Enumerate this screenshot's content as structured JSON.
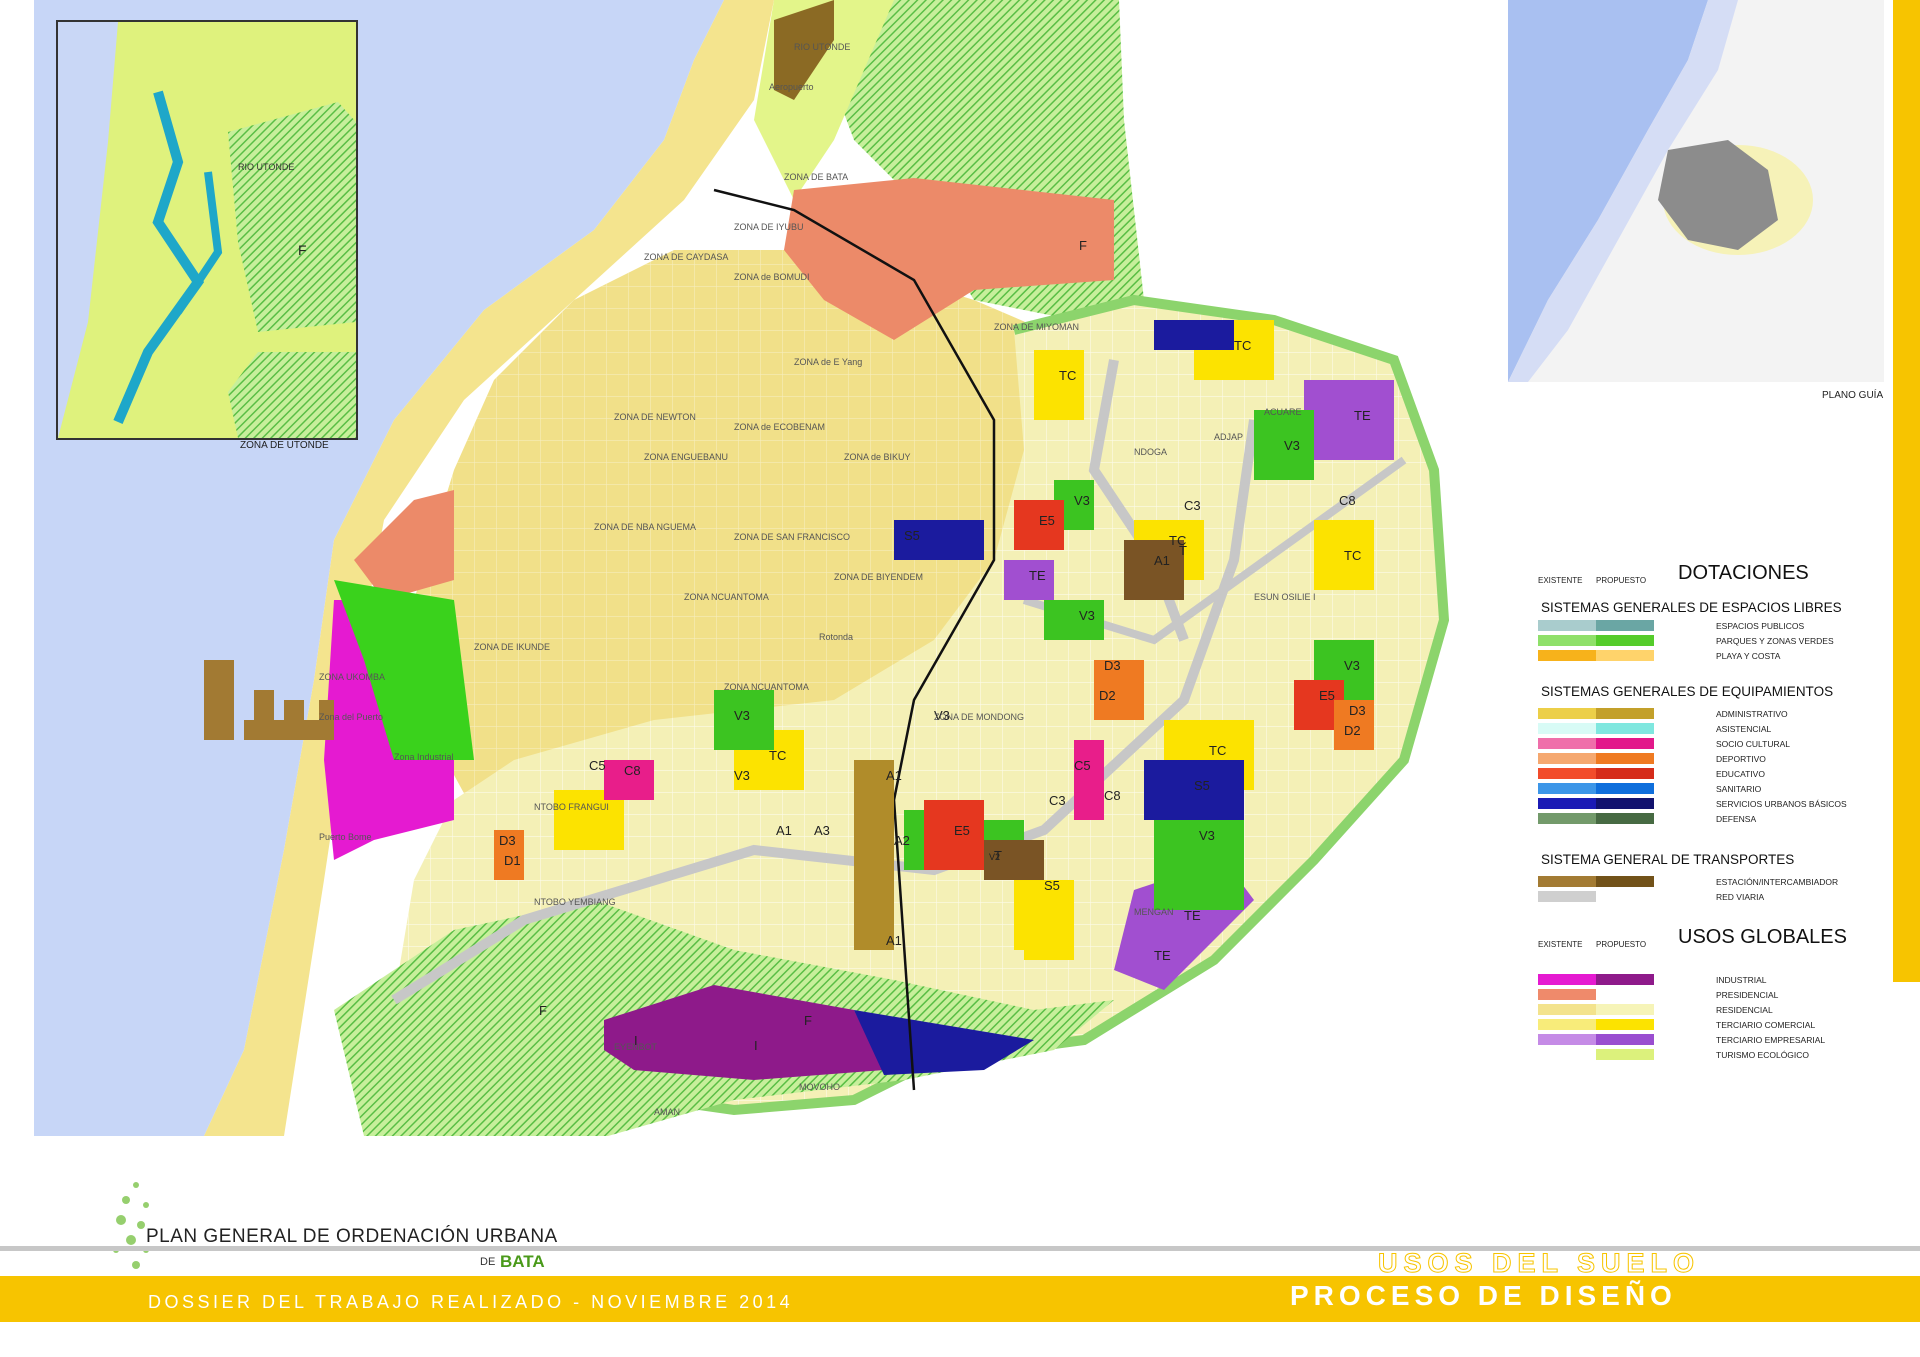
{
  "map": {
    "zones": [
      "ZONA DE BATA",
      "ZONA DE IYUBU",
      "ZONA DE CAYDASA",
      "ZONA de BOMUDI",
      "ZONA de E Yang",
      "ZONA DE MIYOMAN",
      "ZONA DE NEWTON",
      "ZONA ENGUEBANU",
      "ZONA de ECOBENAM",
      "ZONA de BIKUY",
      "ZONA DE NBA NGUEMA",
      "ZONA DE SAN FRANCISCO",
      "ZONA DE BIYENDEM",
      "ZONA NCUANTOMA",
      "ZONA DE IKUNDE",
      "ZONA NCUANTOMA",
      "ZONA DE MONDONG",
      "ZONA UKOMBA",
      "Zona del Puerto",
      "Zona Industrial",
      "Puerto Bome",
      "NTOBO FRANGUI",
      "NTOBO YEMBIANG",
      "EYENBOT",
      "MOVOHO",
      "AMAN",
      "MENGAN",
      "ESUN OSILIE I",
      "NDOGA",
      "ACUARE",
      "ADJAP",
      "Aeropuerto",
      "Rotonda",
      "RIO UTONDE"
    ],
    "codes": [
      "TC",
      "TC",
      "TC",
      "TC",
      "TC",
      "TC",
      "TE",
      "TE",
      "TE",
      "TE",
      "V3",
      "V3",
      "V3",
      "V3",
      "V3",
      "V3",
      "V3",
      "V3",
      "V2",
      "E5",
      "E5",
      "E5",
      "S5",
      "S5",
      "S5",
      "C5",
      "C5",
      "C8",
      "C8",
      "C8",
      "C3",
      "C3",
      "D3",
      "D3",
      "D3",
      "D2",
      "D2",
      "D1",
      "A1",
      "A1",
      "A1",
      "A1",
      "A2",
      "A3",
      "T",
      "T",
      "F",
      "F",
      "F",
      "I",
      "I"
    ],
    "code_colors": {
      "TC": "#fce300",
      "TE": "#a14fd0",
      "V3": "#3cc421",
      "V2": "#7ad66a",
      "E5": "#e5371f",
      "S5": "#1b1b9e",
      "C5": "#e81e8a",
      "C8": "#e81e8a",
      "C3": "#e81e8a",
      "D3": "#ef7a22",
      "D2": "#ef7a22",
      "D1": "#ef7a22",
      "A1": "#b08c2a",
      "A2": "#b08c2a",
      "A3": "#b08c2a",
      "T": "#7a5425",
      "F": "#5ec15a",
      "I": "#8e1a8a"
    }
  },
  "inset": {
    "caption": "ZONA DE UTONDE",
    "labels": [
      "RIO UTONDE",
      "F"
    ]
  },
  "guide": {
    "caption": "PLANO GUÍA"
  },
  "legend": {
    "col_existente": "EXISTENTE",
    "col_propuesto": "PROPUESTO",
    "dotaciones": "DOTACIONES",
    "libres_title": "SISTEMAS GENERALES DE ESPACIOS LIBRES",
    "libres": [
      {
        "label": "ESPACIOS PUBLICOS",
        "existente": "#a9cccd",
        "propuesto": "#6aa6a4"
      },
      {
        "label": "PARQUES Y ZONAS VERDES",
        "existente": "#8fe06a",
        "propuesto": "#55cc2b"
      },
      {
        "label": "PLAYA Y COSTA",
        "existente": "#f7b21b",
        "propuesto": "#ffd36b"
      }
    ],
    "equip_title": "SISTEMAS GENERALES DE EQUIPAMIENTOS",
    "equip": [
      {
        "label": "ADMINISTRATIVO",
        "existente": "#eccf48",
        "propuesto": "#c3a02a"
      },
      {
        "label": "ASISTENCIAL",
        "existente": "#d8fbf6",
        "propuesto": "#7fe7df"
      },
      {
        "label": "SOCIO CULTURAL",
        "existente": "#ef6faa",
        "propuesto": "#e2188a"
      },
      {
        "label": "DEPORTIVO",
        "existente": "#f5a870",
        "propuesto": "#ef7a22"
      },
      {
        "label": "EDUCATIVO",
        "existente": "#f24c2b",
        "propuesto": "#d52c1a"
      },
      {
        "label": "SANITARIO",
        "existente": "#3c96e8",
        "propuesto": "#0f6fdc"
      },
      {
        "label": "SERVICIOS URBANOS BÁSICOS",
        "existente": "#1b1bb5",
        "propuesto": "#12126e"
      },
      {
        "label": "DEFENSA",
        "existente": "#739a6b",
        "propuesto": "#476a43"
      }
    ],
    "transp_title": "SISTEMA GENERAL DE TRANSPORTES",
    "transp": [
      {
        "label": "ESTACIÓN/INTERCAMBIADOR",
        "existente": "#a37b33",
        "propuesto": "#725219"
      },
      {
        "label": "RED VIARIA",
        "existente": "#cfcfcf",
        "propuesto": ""
      }
    ],
    "usos_title": "USOS GLOBALES",
    "usos": [
      {
        "label": "INDUSTRIAL",
        "existente": "#e51ad1",
        "propuesto": "#8e1a8a"
      },
      {
        "label": "PRESIDENCIAL",
        "existente": "#ef8a6b",
        "propuesto": ""
      },
      {
        "label": "RESIDENCIAL",
        "existente": "#f3e38d",
        "propuesto": "#f6f4b8"
      },
      {
        "label": "TERCIARIO COMERCIAL",
        "existente": "#f8ec7a",
        "propuesto": "#fce300"
      },
      {
        "label": "TERCIARIO EMPRESARIAL",
        "existente": "#c58be6",
        "propuesto": "#9a4ed0"
      },
      {
        "label": "TURISMO ECOLÓGICO",
        "existente": "",
        "propuesto": "#dcf17c"
      }
    ]
  },
  "footer": {
    "title": "PLAN GENERAL DE ORDENACIÓN URBANA",
    "de": "DE",
    "bata": "BATA",
    "subtitle": "DOSSIER DEL TRABAJO REALIZADO - NOVIEMBRE 2014",
    "usos": "USOS DEL SUELO",
    "proceso": "PROCESO DE DISEÑO"
  }
}
